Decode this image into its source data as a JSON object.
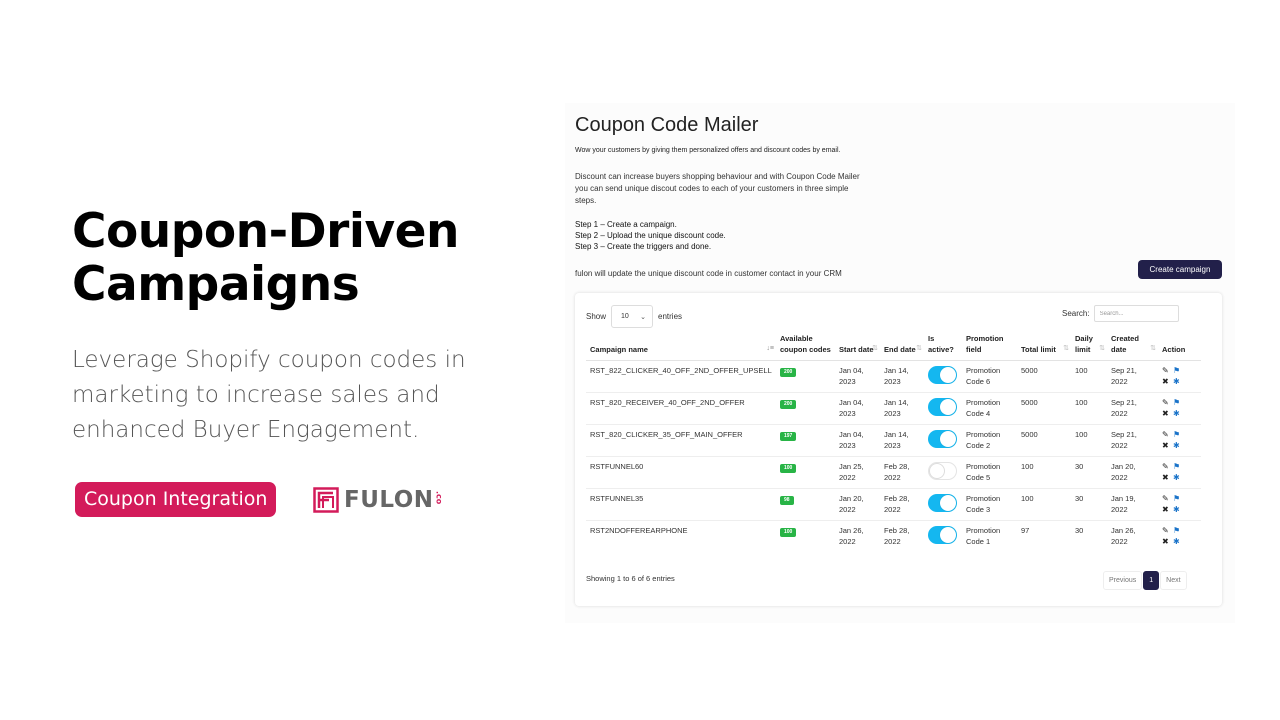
{
  "hero": {
    "title_line1": "Coupon-Driven",
    "title_line2": "Campaigns",
    "description": "Leverage Shopify coupon codes in marketing to increase sales and enhanced Buyer Engagement.",
    "tag_label": "Coupon Integration",
    "logo_text": "FULON",
    "logo_suffix": ".co",
    "brand_color": "#d31b5a"
  },
  "app": {
    "title": "Coupon Code Mailer",
    "subtitle": "Wow your customers by giving them personalized offers and discount codes by email.",
    "paragraph": "Discount can increase buyers shopping behaviour and with Coupon Code Mailer you can send unique discout codes to each of your customers in three simple steps.",
    "steps": [
      "Step 1 – Create a campaign.",
      "Step 2 – Upload the unique discount code.",
      "Step 3 – Create the triggers and done."
    ],
    "note": "fulon will update the unique discount code in customer contact in your CRM",
    "create_button": "Create campaign",
    "show_label": "Show",
    "entries_label": "entries",
    "page_length": "10",
    "search_label": "Search:",
    "search_placeholder": "Search...",
    "search_value": "",
    "columns": [
      "Campaign name",
      "Available coupon codes",
      "Start date",
      "End date",
      "Is active?",
      "Promotion field",
      "Total limit",
      "Daily limit",
      "Created date",
      "Action"
    ],
    "rows": [
      {
        "name": "RST_822_CLICKER_40_OFF_2ND_OFFER_UPSELL",
        "available": "200",
        "start": "Jan 04, 2023",
        "end": "Jan 14, 2023",
        "active": true,
        "promo": "Promotion Code 6",
        "total": "5000",
        "daily": "100",
        "created": "Sep 21, 2022"
      },
      {
        "name": "RST_820_RECEIVER_40_OFF_2ND_OFFER",
        "available": "200",
        "start": "Jan 04, 2023",
        "end": "Jan 14, 2023",
        "active": true,
        "promo": "Promotion Code 4",
        "total": "5000",
        "daily": "100",
        "created": "Sep 21, 2022"
      },
      {
        "name": "RST_820_CLICKER_35_OFF_MAIN_OFFER",
        "available": "197",
        "start": "Jan 04, 2023",
        "end": "Jan 14, 2023",
        "active": true,
        "promo": "Promotion Code 2",
        "total": "5000",
        "daily": "100",
        "created": "Sep 21, 2022"
      },
      {
        "name": "RSTFUNNEL60",
        "available": "100",
        "start": "Jan 25, 2022",
        "end": "Feb 28, 2022",
        "active": false,
        "promo": "Promotion Code 5",
        "total": "100",
        "daily": "30",
        "created": "Jan 20, 2022"
      },
      {
        "name": "RSTFUNNEL35",
        "available": "98",
        "start": "Jan 20, 2022",
        "end": "Feb 28, 2022",
        "active": true,
        "promo": "Promotion Code 3",
        "total": "100",
        "daily": "30",
        "created": "Jan 19, 2022"
      },
      {
        "name": "RST2NDOFFEREARPHONE",
        "available": "100",
        "start": "Jan 26, 2022",
        "end": "Feb 28, 2022",
        "active": true,
        "promo": "Promotion Code 1",
        "total": "97",
        "daily": "30",
        "created": "Jan 26, 2022"
      }
    ],
    "action_icons": [
      "edit-icon",
      "tag-icon",
      "delete-icon",
      "bug-icon"
    ],
    "info": "Showing 1 to 6 of 6 entries",
    "pagination": {
      "previous": "Previous",
      "current": "1",
      "next": "Next"
    },
    "colors": {
      "primary": "#22204a",
      "toggle_on": "#14b7f0",
      "badge": "#28b446",
      "icon_blue": "#1a73c9"
    }
  }
}
